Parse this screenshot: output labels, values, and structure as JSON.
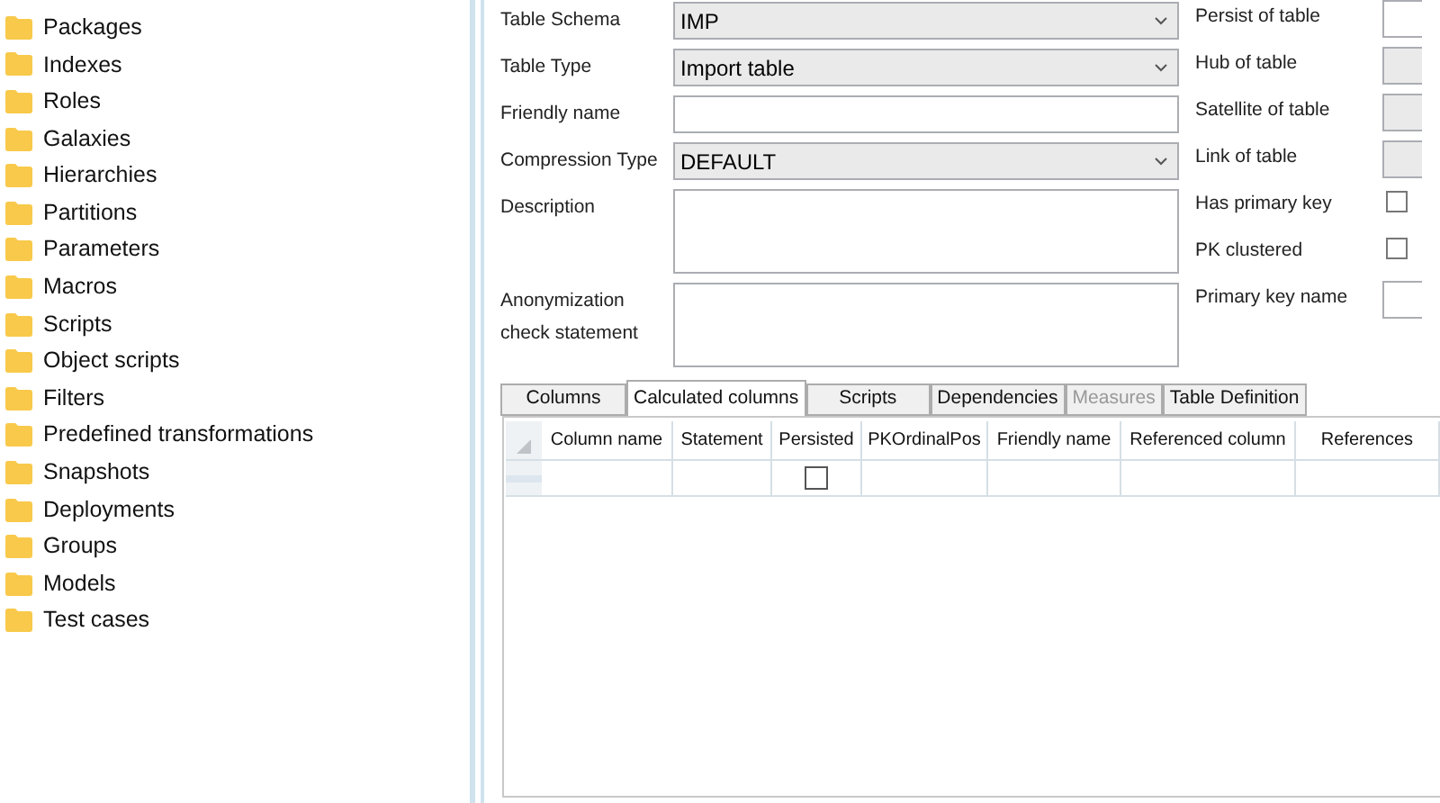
{
  "tree": {
    "items": [
      {
        "label": "Packages"
      },
      {
        "label": "Indexes"
      },
      {
        "label": "Roles"
      },
      {
        "label": "Galaxies"
      },
      {
        "label": "Hierarchies"
      },
      {
        "label": "Partitions"
      },
      {
        "label": "Parameters"
      },
      {
        "label": "Macros"
      },
      {
        "label": "Scripts"
      },
      {
        "label": "Object scripts"
      },
      {
        "label": "Filters"
      },
      {
        "label": "Predefined transformations"
      },
      {
        "label": "Snapshots"
      },
      {
        "label": "Deployments"
      },
      {
        "label": "Groups"
      },
      {
        "label": "Models"
      },
      {
        "label": "Test cases"
      }
    ]
  },
  "form": {
    "fields": [
      {
        "label": "Table Schema",
        "kind": "dropdown",
        "value": "IMP"
      },
      {
        "label": "Table Type",
        "kind": "dropdown",
        "value": "Import table"
      },
      {
        "label": "Friendly name",
        "kind": "text"
      },
      {
        "label": "Compression Type",
        "kind": "dropdown",
        "value": "DEFAULT"
      },
      {
        "label": "Description",
        "kind": "textarea"
      },
      {
        "label": "Anonymization check statement",
        "kind": "textarea"
      }
    ],
    "side_fields": [
      {
        "label": "Persist of table",
        "kind": "text"
      },
      {
        "label": "Hub of table",
        "kind": "dropdown"
      },
      {
        "label": "Satellite of table",
        "kind": "dropdown"
      },
      {
        "label": "Link of table",
        "kind": "dropdown"
      },
      {
        "label": "Has primary key",
        "kind": "checkbox",
        "checked": false
      },
      {
        "label": "PK clustered",
        "kind": "checkbox",
        "checked": false
      },
      {
        "label": "Primary key name",
        "kind": "text"
      }
    ]
  },
  "tabs": [
    {
      "label": "Columns",
      "selected": false,
      "disabled": false
    },
    {
      "label": "Calculated columns",
      "selected": true,
      "disabled": false
    },
    {
      "label": "Scripts",
      "selected": false,
      "disabled": false
    },
    {
      "label": "Dependencies",
      "selected": false,
      "disabled": false
    },
    {
      "label": "Measures",
      "selected": false,
      "disabled": true
    },
    {
      "label": "Table Definition",
      "selected": false,
      "disabled": false
    }
  ],
  "grid": {
    "columns": [
      "Column name",
      "Statement",
      "Persisted",
      "PKOrdinalPos",
      "Friendly name",
      "Referenced column",
      "References"
    ],
    "rows": [
      {
        "persisted": false
      }
    ]
  }
}
